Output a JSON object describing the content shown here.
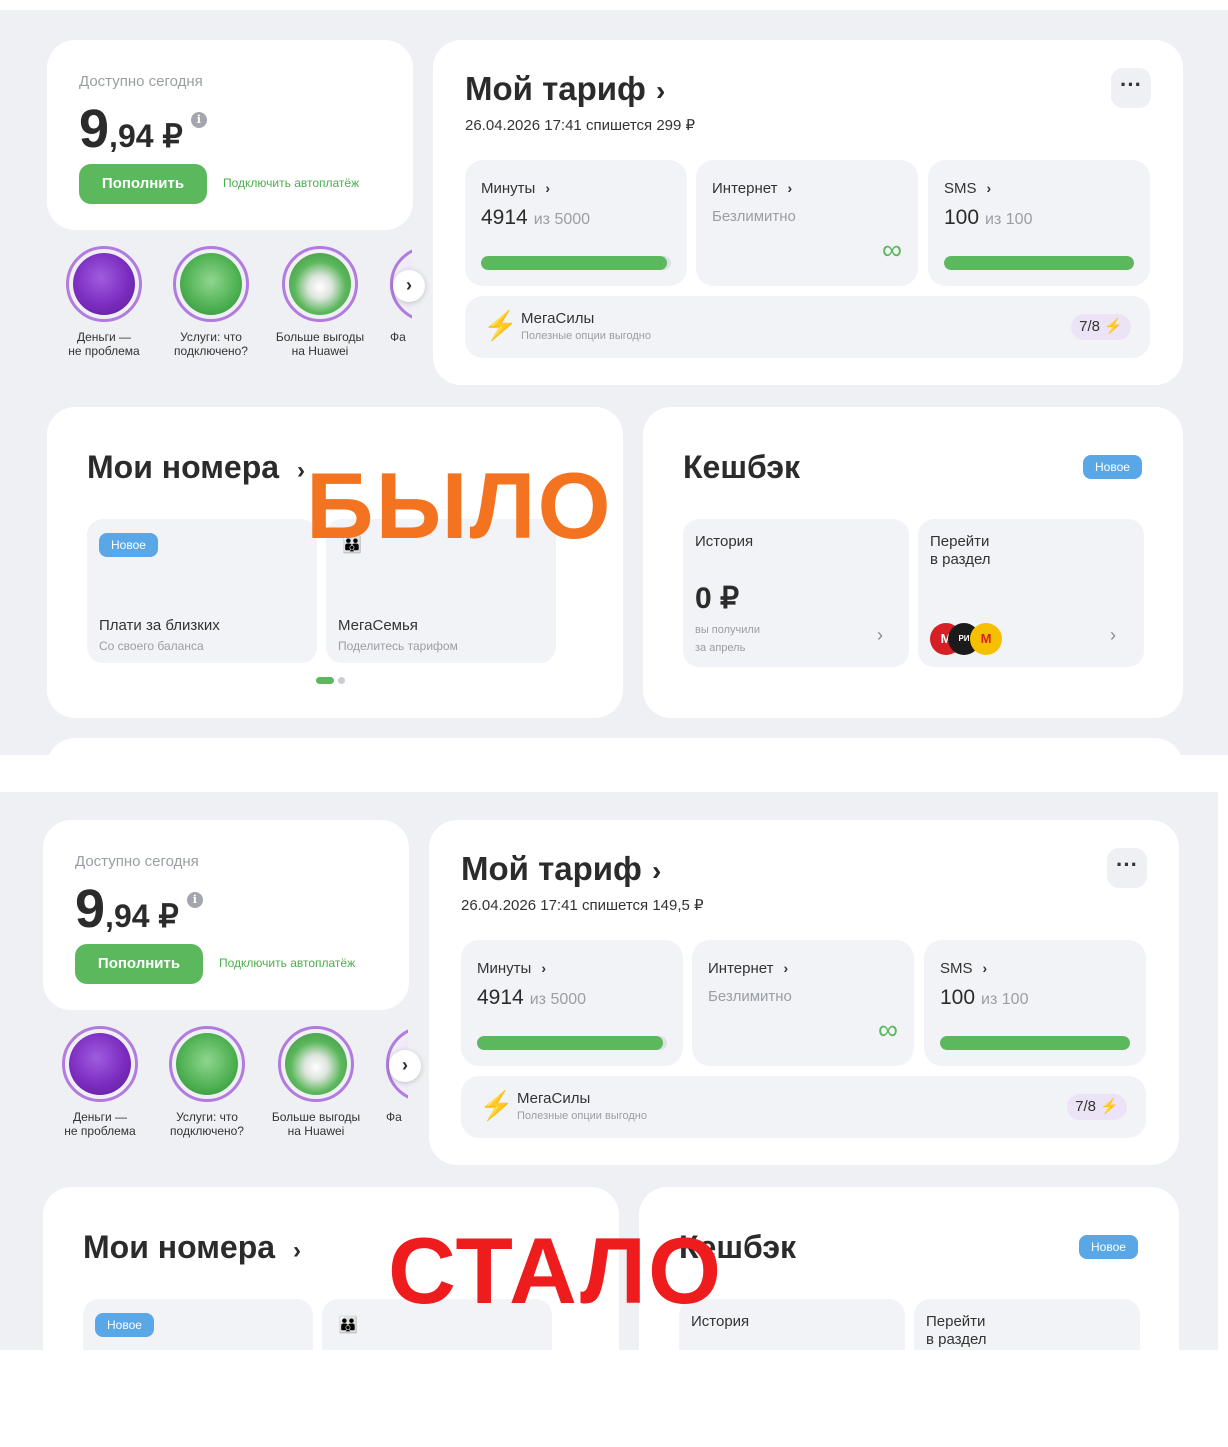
{
  "screens": [
    {
      "label": "БЫЛО",
      "balance": {
        "label": "Доступно сегодня",
        "int": "9",
        "frac": ",94 ₽",
        "info_icon": "info-icon"
      },
      "topup_label": "Пополнить",
      "autopay_label": "Подключить автоплатёж",
      "stories": [
        {
          "label": "Деньги —\nне проблема",
          "color": "#7b2cbf"
        },
        {
          "label": "Услуги: что\nподключено?",
          "color": "#4caf50"
        },
        {
          "label": "Больше выгоды\nна Huawei",
          "color": "#5cb85c"
        },
        {
          "label": "Фа",
          "color": "#e9d4f7"
        }
      ],
      "tariff": {
        "title": "Мой тариф",
        "subtitle": "26.04.2026 17:41 спишется ",
        "subtitle_amount": "299 ₽",
        "minutes": {
          "name": "Минуты",
          "value": "4914",
          "of": "из 5000",
          "progress": 0.98
        },
        "internet": {
          "name": "Интернет",
          "value": "Безлимитно"
        },
        "sms": {
          "name": "SMS",
          "value": "100",
          "of": "из 100",
          "progress": 1.0
        },
        "megasily": {
          "title": "МегаСилы",
          "subtitle": "Полезные опции выгодно",
          "badge": "7/8"
        }
      },
      "numbers": {
        "title": "Мои номера",
        "new_badge": "Новое",
        "tile1_title": "Плати за близких",
        "tile1_sub": "Со своего баланса",
        "tile2_title": "МегаСемья",
        "tile2_sub": "Поделитесь тарифом"
      },
      "cashback": {
        "title": "Кешбэк",
        "new_badge": "Новое",
        "history_title": "История",
        "amount": "0 ₽",
        "note_line1": "вы получили",
        "note_line2": "за апрель",
        "goto_line1": "Перейти",
        "goto_line2": "в раздел"
      }
    },
    {
      "label": "СТАЛО",
      "balance": {
        "label": "Доступно сегодня",
        "int": "9",
        "frac": ",94 ₽",
        "info_icon": "info-icon"
      },
      "topup_label": "Пополнить",
      "autopay_label": "Подключить автоплатёж",
      "stories": [
        {
          "label": "Деньги —\nне проблема",
          "color": "#7b2cbf"
        },
        {
          "label": "Услуги: что\nподключено?",
          "color": "#4caf50"
        },
        {
          "label": "Больше выгоды\nна Huawei",
          "color": "#5cb85c"
        },
        {
          "label": "Фа",
          "color": "#e9d4f7"
        }
      ],
      "tariff": {
        "title": "Мой тариф",
        "subtitle": "26.04.2026 17:41 спишется ",
        "subtitle_amount": "149,5 ₽",
        "minutes": {
          "name": "Минуты",
          "value": "4914",
          "of": "из 5000",
          "progress": 0.98
        },
        "internet": {
          "name": "Интернет",
          "value": "Безлимитно"
        },
        "sms": {
          "name": "SMS",
          "value": "100",
          "of": "из 100",
          "progress": 1.0
        },
        "megasily": {
          "title": "МегаСилы",
          "subtitle": "Полезные опции выгодно",
          "badge": "7/8"
        }
      },
      "numbers": {
        "title": "Мои номера",
        "new_badge": "Новое"
      },
      "cashback": {
        "title": "Кешбэк",
        "new_badge": "Новое",
        "history_title": "История",
        "goto_line1": "Перейти",
        "goto_line2": "в раздел"
      }
    }
  ],
  "colors": {
    "accent_green": "#5cb85c",
    "overlay_before": "#f47320",
    "overlay_after": "#ee1c1c",
    "mega_purple": "#7b2cbf",
    "new_badge": "#5aa7e8"
  }
}
